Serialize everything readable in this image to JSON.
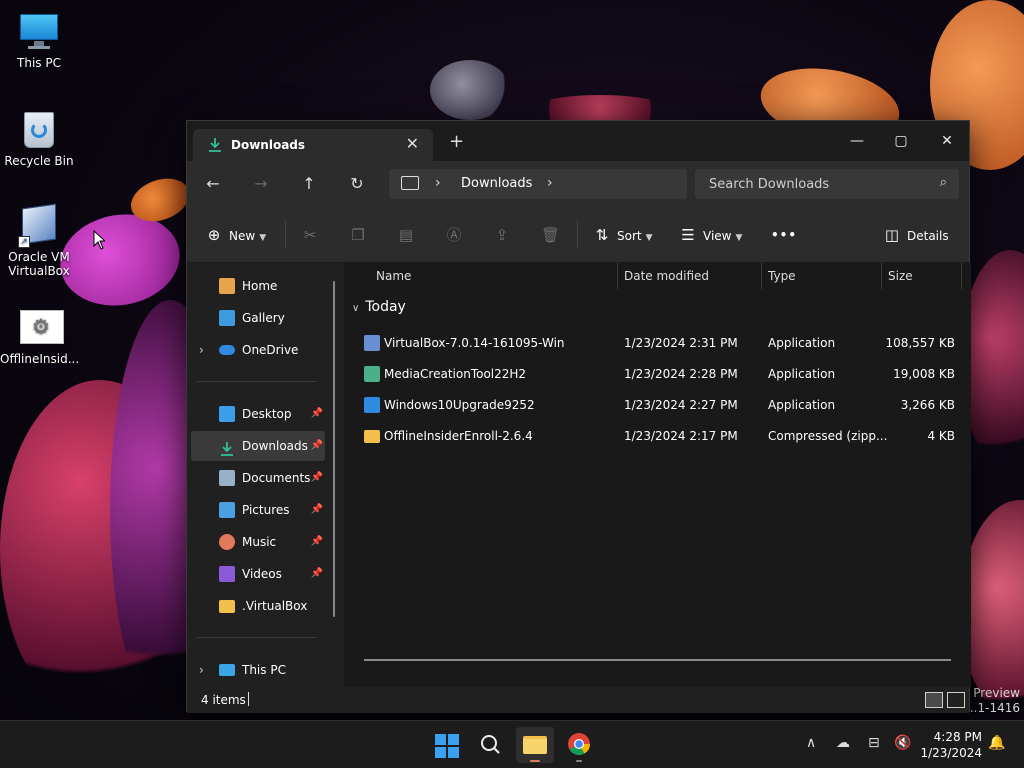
{
  "desktop": {
    "icons": [
      {
        "label": "This PC"
      },
      {
        "label": "Recycle Bin"
      },
      {
        "label": "Oracle VM VirtualBox"
      },
      {
        "label": "OfflineInsid..."
      }
    ],
    "watermark": {
      "line1": "Preview",
      "line2": "..1-1416"
    }
  },
  "explorer": {
    "tab_title": "Downloads",
    "tab_close": "✕",
    "new_tab": "+",
    "window_buttons": {
      "minimize": "—",
      "maximize": "▢",
      "close": "✕"
    },
    "address": {
      "crumb": "Downloads"
    },
    "search": {
      "placeholder": "Search Downloads"
    },
    "commands": {
      "new": "New",
      "sort": "Sort",
      "view": "View",
      "more": "•••",
      "details": "Details"
    },
    "sidebar": {
      "items": [
        {
          "label": "Home",
          "color": "#e8a44a"
        },
        {
          "label": "Gallery",
          "color": "#3d9be0"
        },
        {
          "label": "OneDrive",
          "color": "#2f8ae0"
        },
        {
          "label": "Desktop",
          "color": "#3a9ee8"
        },
        {
          "label": "Downloads",
          "color": "#2fbf9a"
        },
        {
          "label": "Documents",
          "color": "#9ab0c8"
        },
        {
          "label": "Pictures",
          "color": "#4aa0e0"
        },
        {
          "label": "Music",
          "color": "#e07a5a"
        },
        {
          "label": "Videos",
          "color": "#8a5ad8"
        },
        {
          "label": ".VirtualBox",
          "color": "#f2c04a"
        },
        {
          "label": "This PC",
          "color": "#3aa6e8"
        }
      ]
    },
    "columns": {
      "name": "Name",
      "date": "Date modified",
      "type": "Type",
      "size": "Size"
    },
    "group": "Today",
    "files": [
      {
        "name": "VirtualBox-7.0.14-161095-Win",
        "date": "1/23/2024 2:31 PM",
        "type": "Application",
        "size": "108,557 KB",
        "icon_color": "#6a8fd0"
      },
      {
        "name": "MediaCreationTool22H2",
        "date": "1/23/2024 2:28 PM",
        "type": "Application",
        "size": "19,008 KB",
        "icon_color": "#4ab08a"
      },
      {
        "name": "Windows10Upgrade9252",
        "date": "1/23/2024 2:27 PM",
        "type": "Application",
        "size": "3,266 KB",
        "icon_color": "#2f8ae0"
      },
      {
        "name": "OfflineInsiderEnroll-2.6.4",
        "date": "1/23/2024 2:17 PM",
        "type": "Compressed (zipp...",
        "size": "4 KB",
        "icon_color": "#f2c04a"
      }
    ],
    "status": {
      "count": "4 items"
    }
  },
  "taskbar": {
    "time": "4:28 PM",
    "date": "1/23/2024",
    "accent": "#3aa0f0"
  }
}
